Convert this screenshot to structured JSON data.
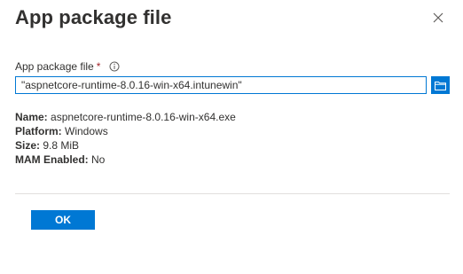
{
  "dialog": {
    "title": "App package file"
  },
  "field": {
    "label": "App package file",
    "required_marker": "*",
    "value": "\"aspnetcore-runtime-8.0.16-win-x64.intunewin\""
  },
  "details": {
    "name_key": "Name:",
    "name_value": "aspnetcore-runtime-8.0.16-win-x64.exe",
    "platform_key": "Platform:",
    "platform_value": "Windows",
    "size_key": "Size:",
    "size_value": "9.8 MiB",
    "mam_key": "MAM Enabled:",
    "mam_value": "No"
  },
  "footer": {
    "ok_label": "OK"
  },
  "icons": {
    "close": "close-icon",
    "info": "info-icon",
    "browse": "folder-icon"
  },
  "colors": {
    "accent": "#0078d4",
    "required": "#a4262c",
    "text": "#323130"
  }
}
